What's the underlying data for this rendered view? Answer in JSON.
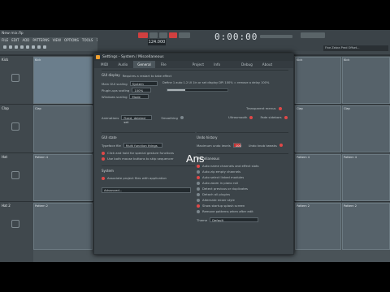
{
  "titlebar": {
    "title": "New mix.flp"
  },
  "menu": [
    "FILE",
    "EDIT",
    "ADD",
    "PATTERNS",
    "VIEW",
    "OPTIONS",
    "TOOLS",
    "?"
  ],
  "toolbar": {
    "tempo": "124.000",
    "time": "0:00:00",
    "hint": "Fine Zebra Pred Offset..."
  },
  "tracks": [
    {
      "name": "Kick"
    },
    {
      "name": "Clap"
    },
    {
      "name": "Hat"
    },
    {
      "name": "Hat 2"
    }
  ],
  "patterns": {
    "row1": [
      "Kick",
      "Kick",
      "Kick",
      "Kick",
      "Kick"
    ],
    "row2": [
      "Clap",
      "Clap",
      "Clap",
      "Clap"
    ],
    "row3": [
      "Pattern 4",
      "Pattern 4",
      "Pattern 4",
      "Pattern 4"
    ],
    "row4": [
      "Pattern 2",
      "Pattern 2",
      "Pattern 2",
      "Pattern 2"
    ]
  },
  "dialog": {
    "title": "Settings - System / Miscellaneous",
    "tabs": [
      "MIDI",
      "Audio",
      "General",
      "File",
      "Project",
      "Info",
      "Debug",
      "About"
    ],
    "active_tab": "General",
    "ui_section": "GUI display",
    "ui_note": "Requires a restart to take effect",
    "main_scaling_label": "Main GUI scaling",
    "main_scaling_value": "System",
    "plugin_scaling_label": "Plugin-ups scaling",
    "plugin_scaling_value": "100%",
    "window_scaling_label": "Windows scaling",
    "window_scaling_value": "Mode",
    "hint_text": "Define 1 auto 1.2 UI 1in or set display DPI 100% = remove a delay 100%",
    "transparent_label": "Transparent menus",
    "animations_label": "Animations",
    "animations_value": "Fixed, deleted set",
    "smoothing_label": "Smoothing",
    "undo_label": "Ultrasmooth",
    "fade_label": "Fade sidebars",
    "gui_section": "GUI state",
    "gui_select_label": "Typeface file",
    "gui_select_value": "Multi function things",
    "gui_opt1": "Click and hold for special gesture functions",
    "gui_opt2": "Use both mouse buttons to skip sequencer",
    "system_section": "System",
    "system_opt": "Associate project files with application",
    "adv_label": "Advanced...",
    "undo_section": "Undo history",
    "undo_max_label": "Maximum undo levels",
    "undo_max_value": "100",
    "undo_opt": "Undo knob tweaks",
    "misc_section": "Miscellaneous",
    "misc_opts": [
      "Auto name channels and effect slots",
      "Auto zip empty channels",
      "Auto select linked modules",
      "Auto zoom in piano roll",
      "Detect previous or duplicates",
      "Detach all plugins",
      "Alternate mixer style",
      "Show startup splash screen",
      "Remove patterns when after edit"
    ],
    "theme_label": "Theme",
    "theme_value": "Default"
  },
  "caption": "Ans"
}
